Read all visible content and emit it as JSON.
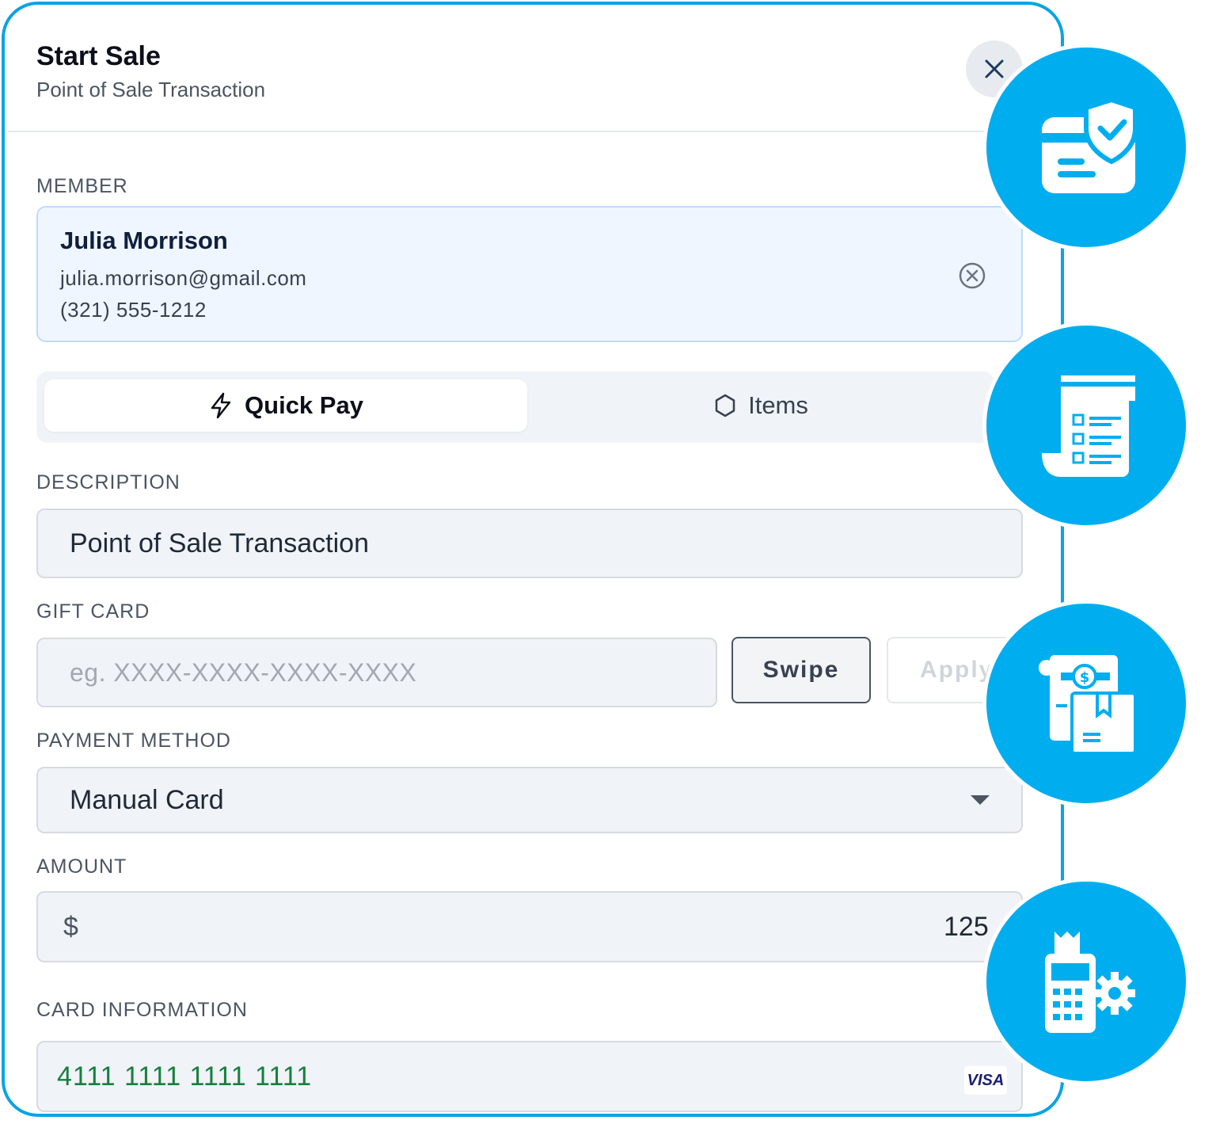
{
  "header": {
    "title": "Start Sale",
    "subtitle": "Point of Sale Transaction"
  },
  "member": {
    "label": "MEMBER",
    "name": "Julia Morrison",
    "email": "julia.morrison@gmail.com",
    "phone": "(321) 555-1212"
  },
  "tabs": [
    {
      "label": "Quick Pay",
      "icon": "lightning-icon",
      "active": true
    },
    {
      "label": "Items",
      "icon": "hexagon-icon",
      "active": false
    }
  ],
  "description": {
    "label": "DESCRIPTION",
    "value": "Point of Sale Transaction"
  },
  "gift_card": {
    "label": "GIFT CARD",
    "placeholder": "eg. XXXX-XXXX-XXXX-XXXX",
    "swipe_label": "Swipe",
    "apply_label": "Apply"
  },
  "payment_method": {
    "label": "PAYMENT METHOD",
    "value": "Manual Card"
  },
  "amount": {
    "label": "AMOUNT",
    "currency": "$",
    "value": "125"
  },
  "card_info": {
    "label": "CARD INFORMATION",
    "number": "4111 1111 1111 1111",
    "brand": "VISA"
  },
  "colors": {
    "accent": "#00aeef",
    "border": "#0aa3e4",
    "card_number": "#15803d"
  },
  "feature_icons": [
    "secure-card-shield-icon",
    "receipt-list-icon",
    "invoice-payment-icon",
    "pos-terminal-settings-icon"
  ]
}
